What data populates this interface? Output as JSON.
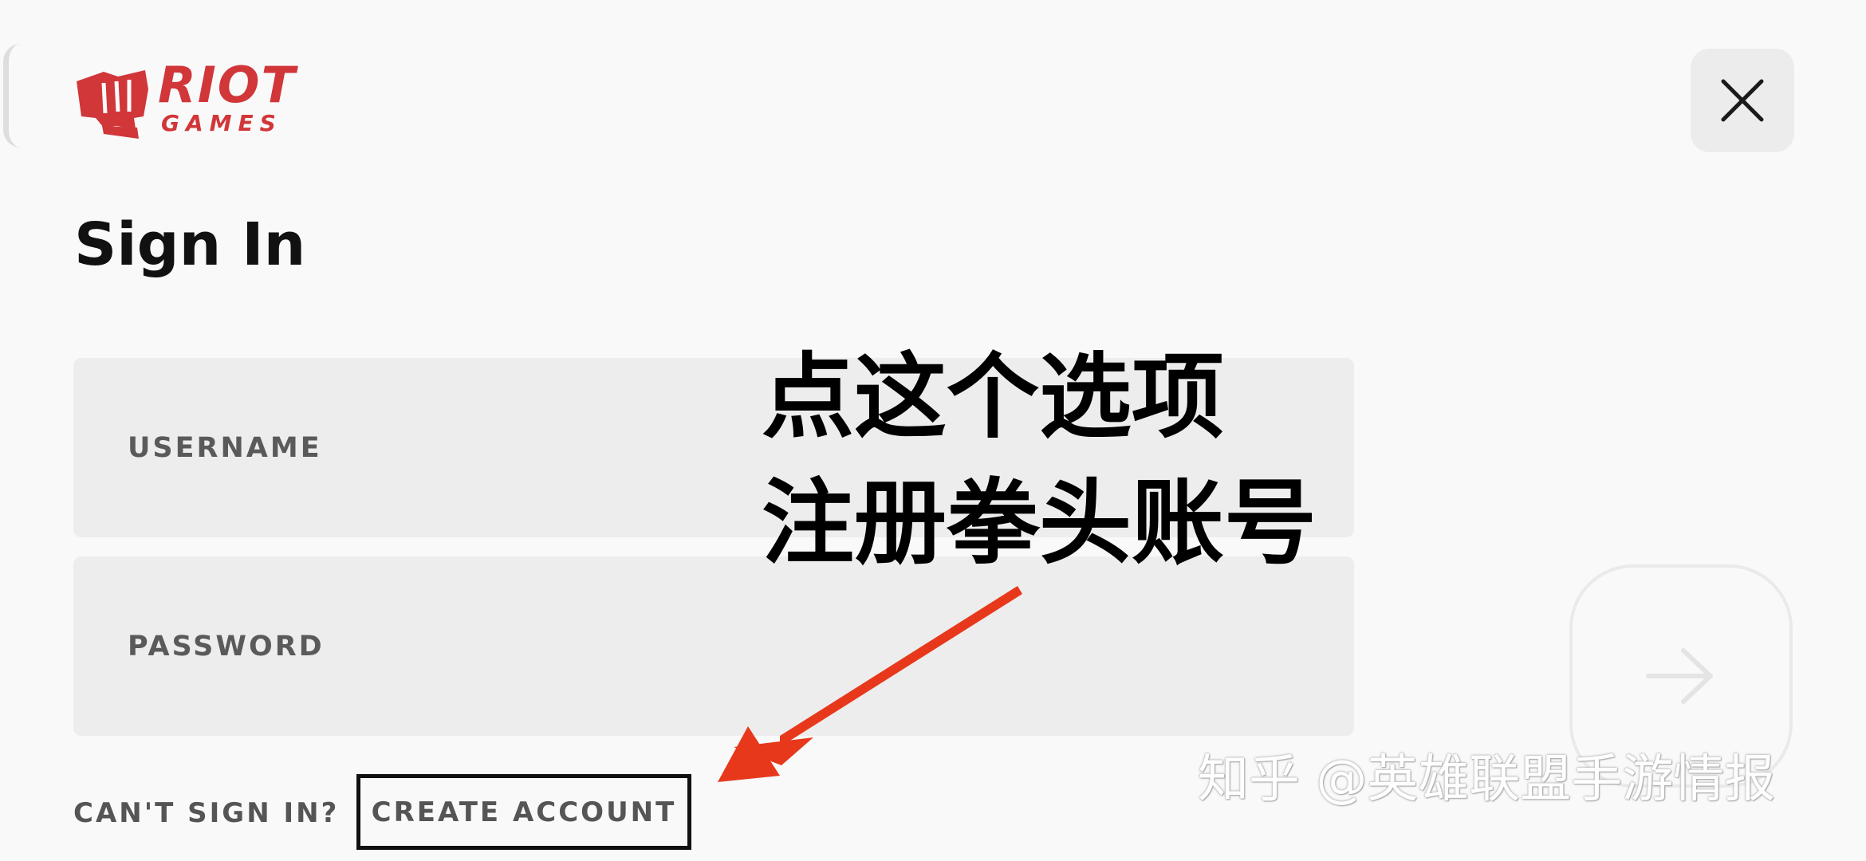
{
  "brand": {
    "name_top": "RIOT",
    "name_bottom": "GAMES",
    "color": "#d13639"
  },
  "dialog": {
    "title": "Sign In",
    "close_icon": "close-icon",
    "fields": {
      "username_label": "USERNAME",
      "password_label": "PASSWORD",
      "username_value": "",
      "password_value": ""
    },
    "links": {
      "cant_sign_in": "CAN'T SIGN IN?",
      "create_account": "CREATE ACCOUNT"
    },
    "submit_icon": "arrow-right-icon"
  },
  "annotation": {
    "line1": "点这个选项",
    "line2": "注册拳头账号",
    "arrow_color": "#e8381c",
    "highlight_border_color": "#111111"
  },
  "watermark": {
    "text": "知乎 @英雄联盟手游情报"
  }
}
